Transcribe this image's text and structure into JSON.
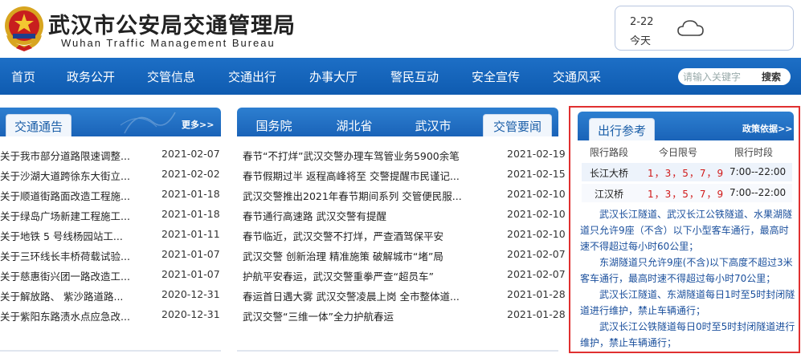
{
  "header": {
    "title": "武汉市公安局交通管理局",
    "subtitle": "Wuhan Traffic Management Bureau"
  },
  "weather": {
    "date": "2-22",
    "today": "今天",
    "icon": "cloud-icon"
  },
  "nav": {
    "items": [
      "首页",
      "政务公开",
      "交管信息",
      "交通出行",
      "办事大厅",
      "警民互动",
      "安全宣传",
      "交通风采"
    ],
    "search_placeholder": "请输入关键字",
    "search_button": "搜索"
  },
  "notice": {
    "tab": "交通通告",
    "more": "更多>>",
    "items": [
      {
        "title": "关于我市部分道路限速调整...",
        "date": "2021-02-07"
      },
      {
        "title": "关于沙湖大道跨徐东大街立...",
        "date": "2021-02-02"
      },
      {
        "title": "关于顺道街路面改造工程施...",
        "date": "2021-01-18"
      },
      {
        "title": "关于绿岛广场新建工程施工...",
        "date": "2021-01-18"
      },
      {
        "title": "关于地铁 5 号线杨园站工...",
        "date": "2021-01-11"
      },
      {
        "title": "关于三环线长丰桥荷载试验...",
        "date": "2021-01-07"
      },
      {
        "title": "关于慈惠街兴团一路改造工...",
        "date": "2021-01-07"
      },
      {
        "title": "关于解放路、 紫沙路道路...",
        "date": "2020-12-31"
      },
      {
        "title": "关于紫阳东路渍水点应急改...",
        "date": "2020-12-31"
      }
    ]
  },
  "news": {
    "tabs": [
      "国务院",
      "湖北省",
      "武汉市",
      "交管要闻"
    ],
    "items": [
      {
        "title": "春节“不打烊”武汉交警办理车驾管业务5900余笔",
        "date": "2021-02-19"
      },
      {
        "title": "春节假期过半 返程高峰将至 交警提醒市民谨记...",
        "date": "2021-02-15"
      },
      {
        "title": "武汉交警推出2021年春节期间系列 交管便民服...",
        "date": "2021-02-10"
      },
      {
        "title": "春节通行高速路 武汉交警有提醒",
        "date": "2021-02-10"
      },
      {
        "title": "春节临近，武汉交警不打烊，严查酒驾保平安",
        "date": "2021-02-10"
      },
      {
        "title": "武汉交警 创新治理 精准施策 破解城市“堵”局",
        "date": "2021-02-07"
      },
      {
        "title": "护航平安春运，武汉交警重拳严查“超员车”",
        "date": "2021-02-07"
      },
      {
        "title": "春运首日遇大雾 武汉交警凌晨上岗 全市整体道...",
        "date": "2021-01-28"
      },
      {
        "title": "武汉交警“三维一体”全力护航春运",
        "date": "2021-01-28"
      }
    ]
  },
  "travel": {
    "tab": "出行参考",
    "more": "政策依据>>",
    "headers": [
      "限行路段",
      "今日限号",
      "限行时段"
    ],
    "rows": [
      {
        "road": "长江大桥",
        "numbers": "1，3，5，7，9",
        "time": "7:00--22:00"
      },
      {
        "road": "江汉桥",
        "numbers": "1，3，5，7，9",
        "time": "7:00--22:00"
      }
    ],
    "notes": [
      "武汉长江隧道、武汉长江公铁隧道、水果湖隧道只允许9座（不含）以下小型客车通行，最高时速不得超过每小时60公里；",
      "东湖隧道只允许9座(不含)以下高度不超过3米客车通行，最高时速不得超过每小时70公里；",
      "武汉长江隧道、东湖隧道每日1时至5时封闭隧道进行维护，禁止车辆通行；",
      "武汉长江公铁隧道每日0时至5时封闭隧道进行维护，禁止车辆通行；"
    ]
  },
  "colors": {
    "nav_blue": "#1565bd",
    "highlight_red": "#d01818",
    "note_blue": "#1a4f9c"
  }
}
